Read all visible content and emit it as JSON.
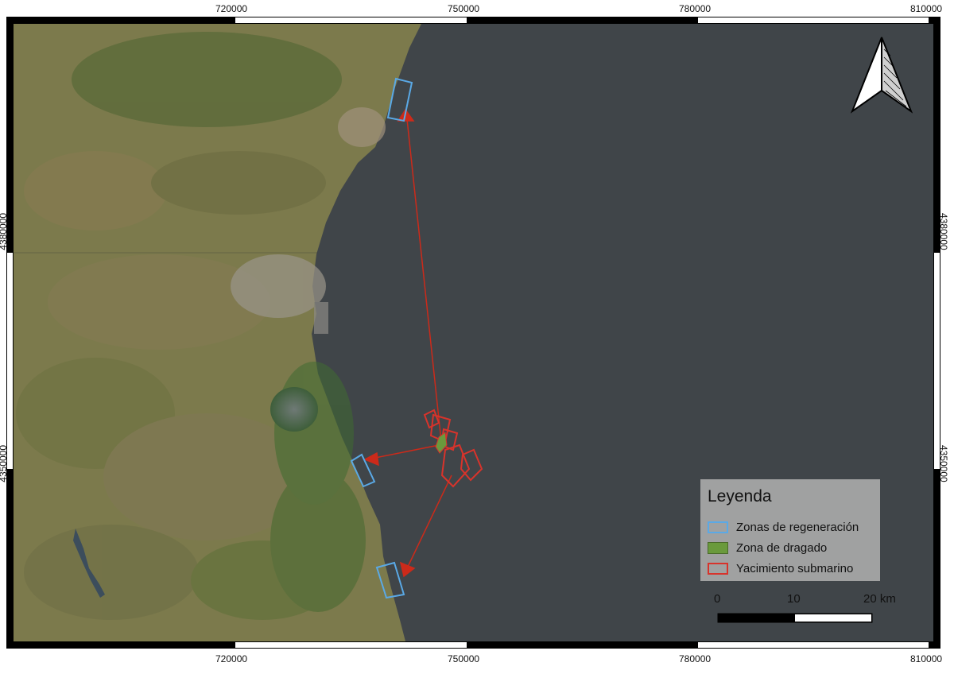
{
  "map": {
    "x_ticks": [
      "720000",
      "750000",
      "780000",
      "810000"
    ],
    "y_ticks": [
      "4380000",
      "4350000"
    ],
    "north_arrow_icon": "north-arrow-icon"
  },
  "legend": {
    "title": "Leyenda",
    "items": [
      {
        "label": "Zonas de regeneración",
        "swatch": "outline",
        "color": "#5aa9e6"
      },
      {
        "label": "Zona de dragado",
        "swatch": "fill",
        "color": "#6a9a3c"
      },
      {
        "label": "Yacimiento submarino",
        "swatch": "outline",
        "color": "#d8332b"
      }
    ]
  },
  "scalebar": {
    "labels": [
      "0",
      "10",
      "20 km"
    ]
  },
  "colors": {
    "sea": "#404549",
    "land": "#7c7a4c",
    "regeneration": "#5aa9e6",
    "dredging": "#6a9a3c",
    "deposit": "#d8332b",
    "arrow": "#cc2a1a"
  }
}
